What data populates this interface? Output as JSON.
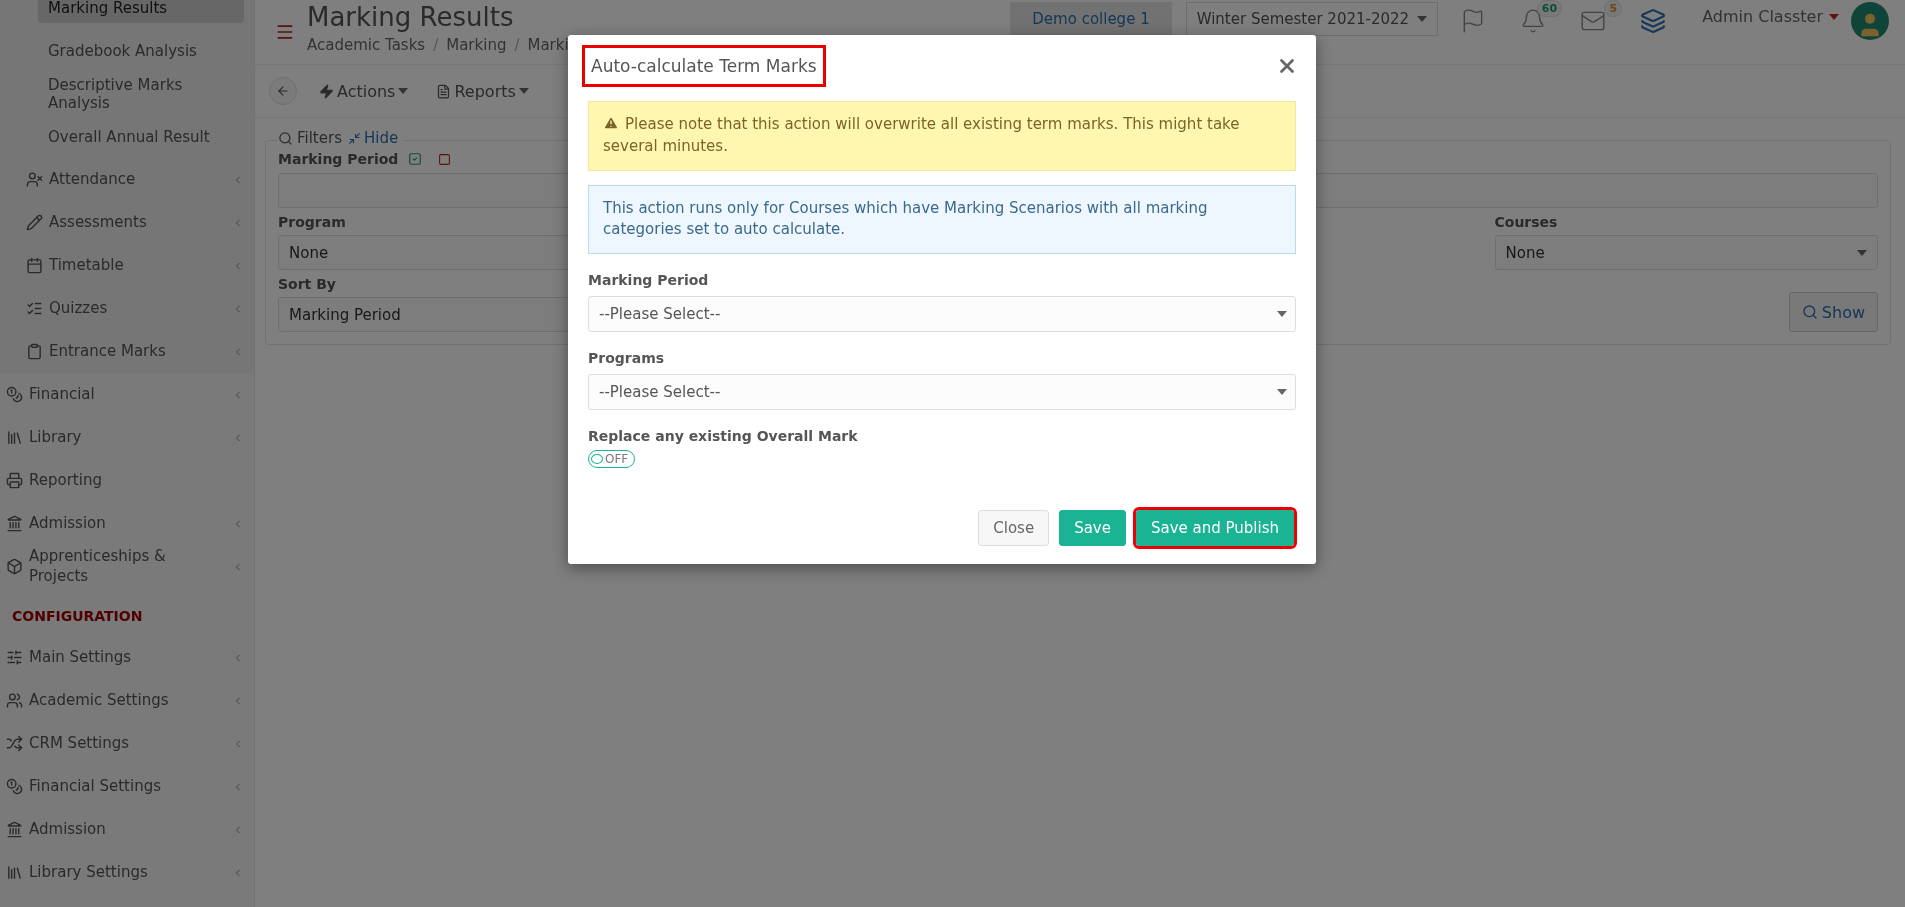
{
  "sidebar": {
    "items": [
      {
        "label": "Marking Results",
        "kind": "subitem",
        "selected": true,
        "has_arrow": false
      },
      {
        "label": "Gradebook Analysis",
        "kind": "subitem",
        "selected": false,
        "has_arrow": false
      },
      {
        "label": "Descriptive Marks Analysis",
        "kind": "subitem",
        "selected": false,
        "has_arrow": false
      },
      {
        "label": "Overall Annual Result",
        "kind": "subitem",
        "selected": false,
        "has_arrow": false
      },
      {
        "label": "Attendance",
        "kind": "subgroup",
        "selected": false,
        "has_arrow": true
      },
      {
        "label": "Assessments",
        "kind": "subgroup",
        "selected": false,
        "has_arrow": true
      },
      {
        "label": "Timetable",
        "kind": "subgroup",
        "selected": false,
        "has_arrow": true
      },
      {
        "label": "Quizzes",
        "kind": "subgroup",
        "selected": false,
        "has_arrow": true
      },
      {
        "label": "Entrance Marks",
        "kind": "subgroup",
        "selected": false,
        "has_arrow": true
      },
      {
        "label": "Financial",
        "kind": "item",
        "selected": false,
        "has_arrow": true
      },
      {
        "label": "Library",
        "kind": "item",
        "selected": false,
        "has_arrow": true
      },
      {
        "label": "Reporting",
        "kind": "item",
        "selected": false,
        "has_arrow": false
      },
      {
        "label": "Admission",
        "kind": "item",
        "selected": false,
        "has_arrow": true
      },
      {
        "label": "Apprenticeships & Projects",
        "kind": "item",
        "selected": false,
        "has_arrow": true
      },
      {
        "label": "CONFIGURATION",
        "kind": "section"
      },
      {
        "label": "Main Settings",
        "kind": "item",
        "selected": false,
        "has_arrow": true
      },
      {
        "label": "Academic Settings",
        "kind": "item",
        "selected": false,
        "has_arrow": true
      },
      {
        "label": "CRM Settings",
        "kind": "item",
        "selected": false,
        "has_arrow": true
      },
      {
        "label": "Financial Settings",
        "kind": "item",
        "selected": false,
        "has_arrow": true
      },
      {
        "label": "Admission",
        "kind": "item",
        "selected": false,
        "has_arrow": true
      },
      {
        "label": "Library Settings",
        "kind": "item",
        "selected": false,
        "has_arrow": true
      }
    ]
  },
  "header": {
    "title": "Marking Results",
    "breadcrumbs": [
      "Academic Tasks",
      "Marking",
      "Marki"
    ],
    "breadcrumb_separator": "/",
    "college": "Demo college 1",
    "semester": "Winter Semester 2021-2022",
    "notifications": "60",
    "messages": "5",
    "user": "Admin Classter"
  },
  "toolbar": {
    "buttons": [
      "Actions",
      "Reports"
    ]
  },
  "filters": {
    "title": "Filters",
    "hide": "Hide",
    "marking_period": "Marking Period",
    "program": {
      "label": "Program",
      "value": "None"
    },
    "courses": {
      "label": "Courses",
      "value": "None"
    },
    "sort_by": {
      "label": "Sort By",
      "value": "Marking Period"
    },
    "show": "Show"
  },
  "modal": {
    "title": "Auto-calculate Term Marks",
    "title_highlighted": true,
    "warning": "Please note that this action will overwrite all existing term marks. This might take several minutes.",
    "info": "This action runs only for Courses which have Marking Scenarios with all marking categories set to auto calculate.",
    "fields": [
      {
        "label": "Marking Period",
        "value": "--Please Select--"
      },
      {
        "label": "Programs",
        "value": "--Please Select--"
      }
    ],
    "toggle": {
      "label": "Replace any existing Overall Mark",
      "on": false,
      "text": "OFF"
    },
    "buttons": [
      {
        "label": "Close",
        "kind": "default",
        "highlighted": false
      },
      {
        "label": "Save",
        "kind": "primary",
        "highlighted": false
      },
      {
        "label": "Save and Publish",
        "kind": "primary",
        "highlighted": true
      }
    ]
  }
}
